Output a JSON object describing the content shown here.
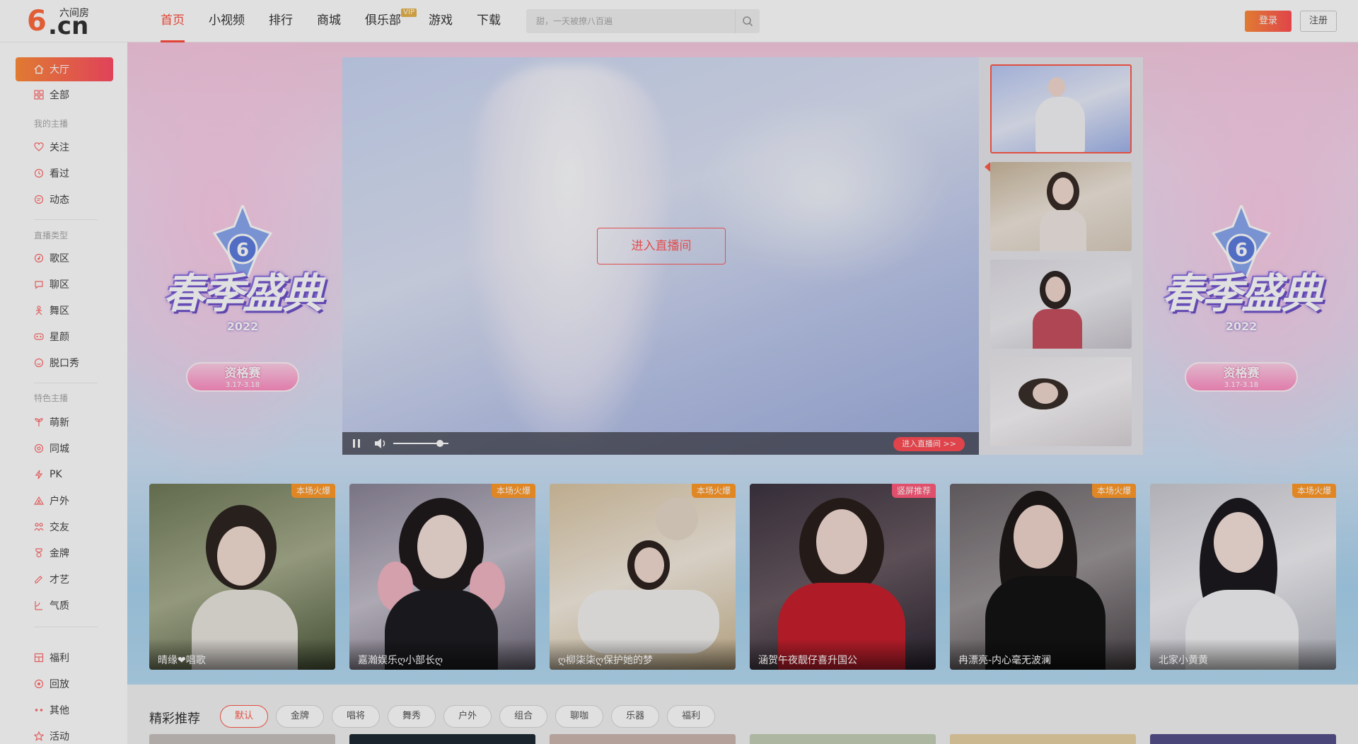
{
  "header": {
    "logo_text": "6.cn",
    "logo_sub": "六间房",
    "nav": [
      {
        "label": "首页",
        "active": true
      },
      {
        "label": "小视频"
      },
      {
        "label": "排行"
      },
      {
        "label": "商城"
      },
      {
        "label": "俱乐部",
        "badge": "VIP"
      },
      {
        "label": "游戏"
      },
      {
        "label": "下载"
      }
    ],
    "search_placeholder": "甜，一天被撩八百遍",
    "login_label": "登录",
    "register_label": "注册"
  },
  "sidebar": {
    "items": [
      {
        "label": "大厅",
        "icon": "home-icon",
        "active": true
      },
      {
        "label": "全部",
        "icon": "grid-icon"
      }
    ],
    "group_mine": "我的主播",
    "mine": [
      {
        "label": "关注",
        "icon": "heart-icon"
      },
      {
        "label": "看过",
        "icon": "clock-icon"
      },
      {
        "label": "动态",
        "icon": "chat-icon"
      }
    ],
    "group_type": "直播类型",
    "types": [
      {
        "label": "歌区",
        "icon": "music-icon"
      },
      {
        "label": "聊区",
        "icon": "bubble-icon"
      },
      {
        "label": "舞区",
        "icon": "dance-icon"
      },
      {
        "label": "星颜",
        "icon": "mask-icon"
      },
      {
        "label": "脱口秀",
        "icon": "mic-icon"
      }
    ],
    "group_special": "特色主播",
    "specials": [
      {
        "label": "萌新",
        "icon": "sprout-icon"
      },
      {
        "label": "同城",
        "icon": "location-icon"
      },
      {
        "label": "PK",
        "icon": "lightning-icon"
      },
      {
        "label": "户外",
        "icon": "tent-icon"
      },
      {
        "label": "交友",
        "icon": "people-icon"
      },
      {
        "label": "金牌",
        "icon": "medal-icon"
      },
      {
        "label": "才艺",
        "icon": "palette-icon"
      },
      {
        "label": "气质",
        "icon": "flower-icon"
      }
    ],
    "others": [
      {
        "label": "福利",
        "icon": "gift-icon"
      },
      {
        "label": "回放",
        "icon": "replay-icon"
      },
      {
        "label": "其他",
        "icon": "more-icon"
      },
      {
        "label": "活动",
        "icon": "star-icon"
      }
    ]
  },
  "banner": {
    "event_title": "春季盛典",
    "event_year": "2022",
    "event_pill": "资格赛",
    "event_dates": "3.17-3.18"
  },
  "player": {
    "enter_label": "进入直播间",
    "enter_small_label": "进入直播间 >>",
    "volume": 0.85
  },
  "cards": [
    {
      "name": "晴缘❤唱歌",
      "tag": "本场火爆"
    },
    {
      "name": "嘉瀚娱乐ღ小部长ღ",
      "tag": "本场火爆"
    },
    {
      "name": "ღ柳柒柒ღ保护她的梦",
      "tag": "本场火爆"
    },
    {
      "name": "涵贺午夜靓仔喜升国公",
      "tag": "竖屏推荐"
    },
    {
      "name": "冉漂亮-内心毫无波澜",
      "tag": "本场火爆"
    },
    {
      "name": "北家小黄黄",
      "tag": "本场火爆"
    }
  ],
  "recommend": {
    "title": "精彩推荐",
    "filters": [
      "默认",
      "金牌",
      "唱将",
      "舞秀",
      "户外",
      "组合",
      "聊咖",
      "乐器",
      "福利"
    ]
  },
  "colors": {
    "accent": "#ff4d3d",
    "button_gradient_start": "#ff8c3a",
    "button_gradient_end": "#ff4f55"
  }
}
